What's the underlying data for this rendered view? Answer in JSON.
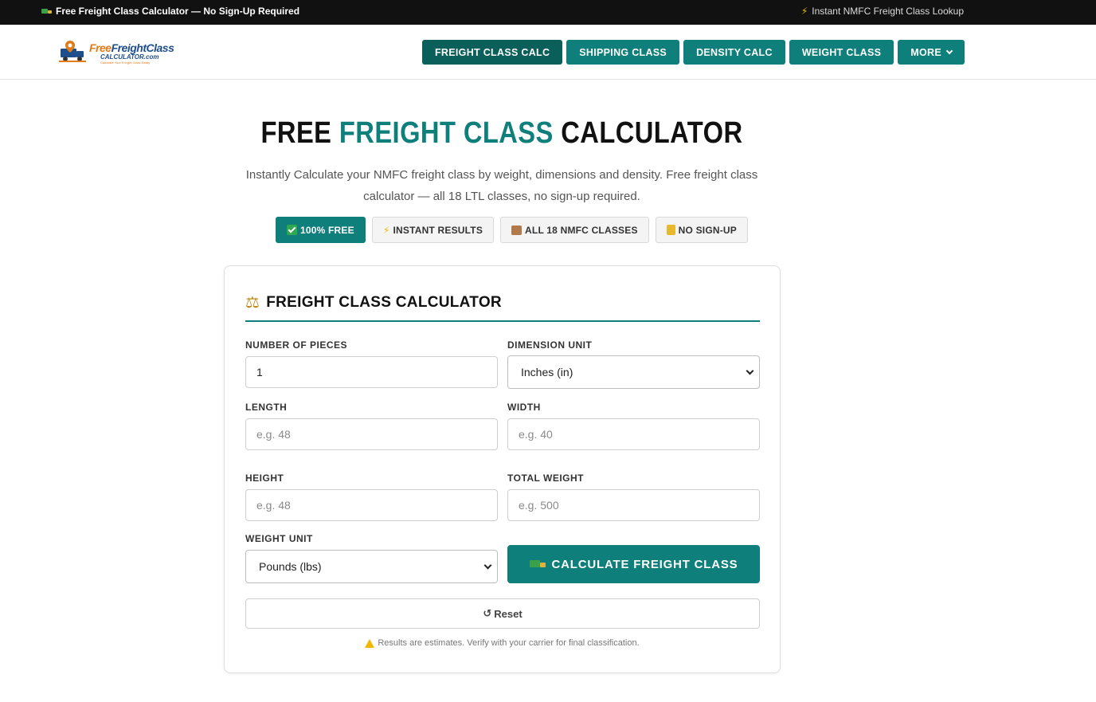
{
  "topbar": {
    "left_text": "Free Freight Class Calculator — No Sign-Up Required",
    "right_text": "Instant NMFC Freight Class Lookup"
  },
  "logo": {
    "text_free": "Free",
    "text_main": "FreightClass",
    "text_domain": "CALCULATOR.com",
    "tagline": "Calculate Your Freight Class Easily"
  },
  "nav": {
    "items": [
      {
        "label": "FREIGHT CLASS CALC"
      },
      {
        "label": "SHIPPING CLASS"
      },
      {
        "label": "DENSITY CALC"
      },
      {
        "label": "WEIGHT CLASS"
      },
      {
        "label": "MORE"
      }
    ]
  },
  "hero": {
    "title_pre": "FREE ",
    "title_accent": "FREIGHT CLASS",
    "title_post": " CALCULATOR",
    "subtitle": "Instantly Calculate your NMFC freight class by weight, dimensions and density. Free freight class calculator — all 18 LTL classes, no sign-up required."
  },
  "badges": [
    "100% FREE",
    "INSTANT RESULTS",
    "ALL 18 NMFC CLASSES",
    "NO SIGN-UP"
  ],
  "calculator": {
    "title": "FREIGHT CLASS CALCULATOR",
    "pieces": {
      "label": "NUMBER OF PIECES",
      "value": "1"
    },
    "dimension_unit": {
      "label": "DIMENSION UNIT",
      "value": "Inches (in)"
    },
    "length": {
      "label": "LENGTH",
      "placeholder": "e.g. 48"
    },
    "width": {
      "label": "WIDTH",
      "placeholder": "e.g. 40"
    },
    "height": {
      "label": "HEIGHT",
      "placeholder": "e.g. 48"
    },
    "weight": {
      "label": "TOTAL WEIGHT",
      "placeholder": "e.g. 500"
    },
    "weight_unit": {
      "label": "WEIGHT UNIT",
      "value": "Pounds (lbs)"
    },
    "calculate_label": "CALCULATE FREIGHT CLASS",
    "reset_label": "Reset",
    "note": "Results are estimates. Verify with your carrier for final classification."
  },
  "colors": {
    "accent": "#0e7f7a",
    "accent_dark": "#0a5f5b",
    "topbar": "#111111"
  }
}
